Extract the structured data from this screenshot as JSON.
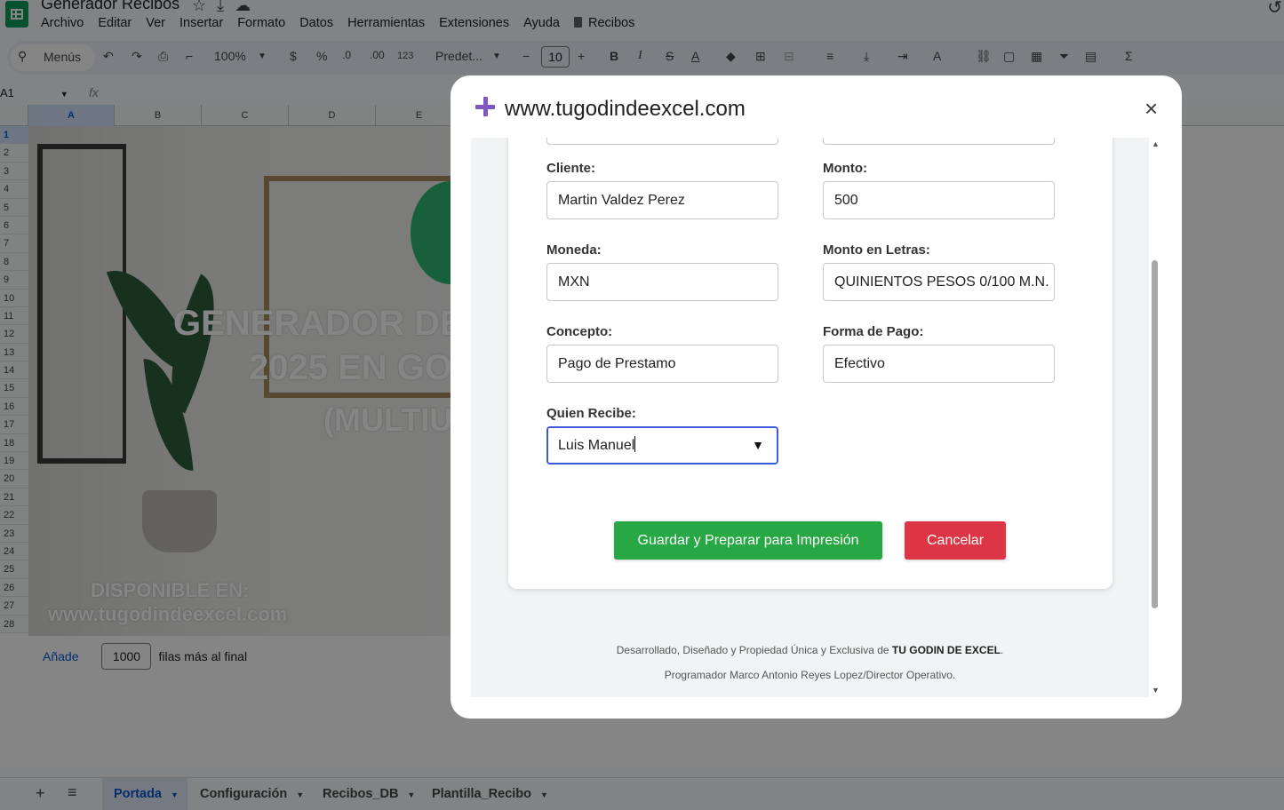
{
  "app": {
    "doc_title": "Generador Recibos",
    "menu": [
      "Archivo",
      "Editar",
      "Ver",
      "Insertar",
      "Formato",
      "Datos",
      "Herramientas",
      "Extensiones",
      "Ayuda"
    ],
    "menu_extra": "Recibos"
  },
  "toolbar": {
    "search": "Menús",
    "zoom": "100%",
    "currency": "$",
    "percent": "%",
    "dec_less": ".0",
    "dec_more": ".00",
    "number_format": "123",
    "font": "Predet...",
    "font_size": "10",
    "bold": "B",
    "italic": "I",
    "sum": "Σ"
  },
  "formula_bar": {
    "cell_ref": "A1",
    "fx": "fx"
  },
  "columns": [
    "A",
    "B",
    "C",
    "D",
    "E"
  ],
  "rows": [
    "1",
    "2",
    "3",
    "4",
    "5",
    "6",
    "7",
    "8",
    "9",
    "10",
    "11",
    "12",
    "13",
    "14",
    "15",
    "16",
    "17",
    "18",
    "19",
    "20",
    "21",
    "22",
    "23",
    "24",
    "25",
    "26",
    "27",
    "28"
  ],
  "cover": {
    "line1": "GENERADOR DE",
    "line2": "2025 EN GO",
    "line3": "(MULTIUS",
    "available": "DISPONIBLE EN:",
    "site": "www.tugodindeexcel.com"
  },
  "add_rows": {
    "button": "Añade",
    "count": "1000",
    "suffix": "filas más al final"
  },
  "sheet_tabs": [
    "Portada",
    "Configuración",
    "Recibos_DB",
    "Plantilla_Recibo"
  ],
  "modal": {
    "title": "www.tugodindeexcel.com",
    "close": "×",
    "fields": {
      "cliente": {
        "label": "Cliente:",
        "value": "Martin Valdez Perez"
      },
      "monto": {
        "label": "Monto:",
        "value": "500"
      },
      "moneda": {
        "label": "Moneda:",
        "value": "MXN"
      },
      "monto_letras": {
        "label": "Monto en Letras:",
        "value": "QUINIENTOS PESOS 0/100 M.N."
      },
      "concepto": {
        "label": "Concepto:",
        "value": "Pago de Prestamo"
      },
      "forma_pago": {
        "label": "Forma de Pago:",
        "value": "Efectivo"
      },
      "quien_recibe": {
        "label": "Quien Recibe:",
        "value": "Luis Manuel"
      }
    },
    "save_label": "Guardar y Preparar para Impresión",
    "cancel_label": "Cancelar",
    "footer": {
      "line1_prefix": "Desarrollado, Diseñado y Propiedad Única y Exclusiva de ",
      "line1_brand": "TU GODIN DE EXCEL",
      "line1_suffix": ".",
      "line2": "Programador Marco Antonio Reyes Lopez/Director Operativo."
    }
  },
  "colors": {
    "save": "#28a745",
    "cancel": "#dc3545",
    "accent": "#7e57c2",
    "focus": "#3b5bdb"
  }
}
